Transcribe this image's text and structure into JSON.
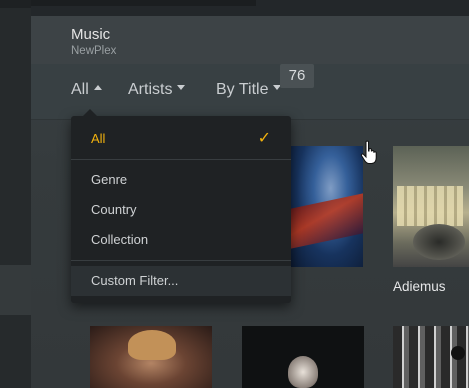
{
  "header": {
    "title": "Music",
    "subtitle": "NewPlex"
  },
  "filterbar": {
    "filter_label": "All",
    "type_label": "Artists",
    "sort_label": "By Title",
    "count": "76"
  },
  "dropdown": {
    "items": [
      {
        "label": "All",
        "selected": true
      },
      {
        "label": "Genre"
      },
      {
        "label": "Country"
      },
      {
        "label": "Collection"
      },
      {
        "label": "Custom Filter..."
      }
    ],
    "accent_color": "#f2b20e"
  },
  "posters": {
    "visible_title": "Adiemus"
  }
}
